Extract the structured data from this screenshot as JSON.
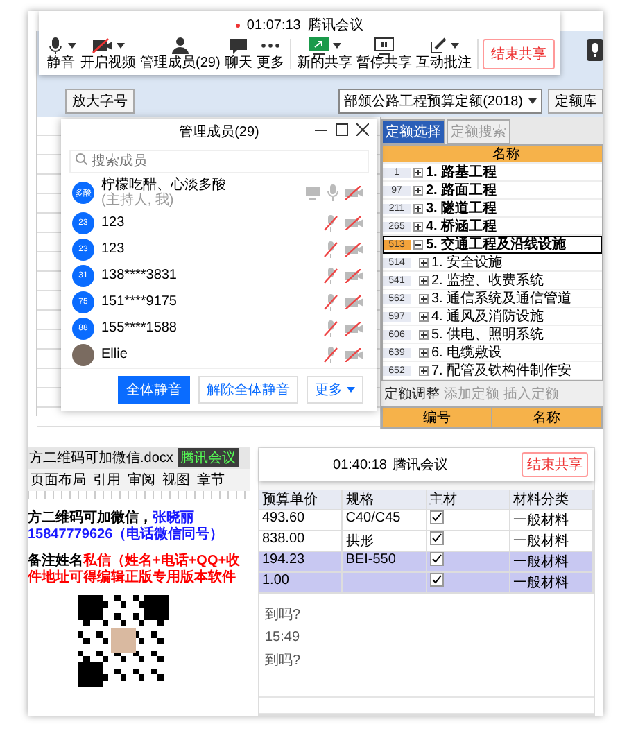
{
  "meeting_toolbar": {
    "timer": "01:07:13",
    "title": "腾讯会议",
    "buttons": [
      {
        "label": "静音",
        "caret": true
      },
      {
        "label": "开启视频",
        "caret": true
      },
      {
        "label": "管理成员(29)",
        "caret": false
      },
      {
        "label": "聊天",
        "caret": false
      },
      {
        "label": "更多",
        "caret": false
      },
      {
        "label": "新的共享",
        "caret": true
      },
      {
        "label": "暂停共享",
        "caret": false
      },
      {
        "label": "互动批注",
        "caret": true
      }
    ],
    "end_button": "结束共享"
  },
  "app": {
    "zoom_button": "放大字号",
    "quota_dropdown": "部颁公路工程预算定额(2018)",
    "library_button": "定额库",
    "adjust_button": "定额调整",
    "tabs": [
      {
        "label": "定额选择",
        "selected": true
      },
      {
        "label": "定额搜索",
        "selected": false
      }
    ],
    "tree": {
      "header": "名称",
      "items": [
        {
          "code": "1",
          "name": "1. 路基工程",
          "expanded": false,
          "selected": false
        },
        {
          "code": "97",
          "name": "2. 路面工程",
          "expanded": false,
          "selected": false
        },
        {
          "code": "211",
          "name": "3. 隧道工程",
          "expanded": false,
          "selected": false
        },
        {
          "code": "265",
          "name": "4. 桥涵工程",
          "expanded": false,
          "selected": false
        },
        {
          "code": "513",
          "name": "5. 交通工程及沿线设施",
          "expanded": true,
          "selected": true,
          "children": [
            {
              "code": "514",
              "name": "1. 安全设施"
            },
            {
              "code": "541",
              "name": "2. 监控、收费系统"
            },
            {
              "code": "562",
              "name": "3. 通信系统及通信管道"
            },
            {
              "code": "597",
              "name": "4. 通风及消防设施"
            },
            {
              "code": "606",
              "name": "5. 供电、照明系统"
            },
            {
              "code": "639",
              "name": "6. 电缆敷设"
            },
            {
              "code": "652",
              "name": "7. 配管及铁构件制作安"
            }
          ]
        }
      ]
    },
    "actions": [
      "添加定额",
      "插入定额"
    ],
    "grid_columns": [
      "编号",
      "名称"
    ]
  },
  "members_dialog": {
    "title": "管理成员(29)",
    "search": {
      "placeholder": "搜索成员"
    },
    "members": [
      {
        "kind": "number",
        "avatar": "多酸",
        "name": "柠檬吃醋、心淡多酸",
        "role": "(主持人, 我)",
        "mic_on": true
      },
      {
        "kind": "number",
        "avatar": "23",
        "name": "123",
        "mic_on": false
      },
      {
        "kind": "number",
        "avatar": "23",
        "name": "123",
        "mic_on": false
      },
      {
        "kind": "number",
        "avatar": "31",
        "name": "138****3831",
        "mic_on": false
      },
      {
        "kind": "number",
        "avatar": "75",
        "name": "151****9175",
        "mic_on": false
      },
      {
        "kind": "number",
        "avatar": "88",
        "name": "155****1588",
        "mic_on": false
      },
      {
        "kind": "photo",
        "name": "Ellie",
        "mic_on": false
      }
    ],
    "buttons": [
      {
        "label": "全体静音",
        "kind": "primary"
      },
      {
        "label": "解除全体静音",
        "kind": "plain"
      },
      {
        "label": "更多",
        "kind": "menu"
      }
    ]
  },
  "document": {
    "filename": "方二维码可加微信.docx",
    "meeting_badge": "腾讯会议",
    "menu": [
      "页面布局",
      "引用",
      "审阅",
      "视图",
      "章节"
    ],
    "lines": [
      [
        {
          "text": "方二维码可加微信，",
          "color": "#000000"
        },
        {
          "text": "张晓丽 15847779626（电话微信同号）",
          "color": "#1a1aff"
        }
      ],
      [
        {
          "text": "备注姓名",
          "color": "#000000"
        },
        {
          "text": "私信（姓名+电话+QQ+收件地址可得编辑正版专用版本软件",
          "color": "#ff0000"
        }
      ]
    ]
  },
  "second_screen": {
    "timer": "01:40:18",
    "title": "腾讯会议",
    "end_button": "结束共享",
    "columns": [
      "预算单价",
      "规格",
      "主材",
      "材料分类"
    ],
    "rows": [
      {
        "cells": [
          "493.60",
          "C40/C45"
        ],
        "main_material": true,
        "category": "一般材料",
        "selected": false
      },
      {
        "cells": [
          "838.00",
          "拱形"
        ],
        "main_material": true,
        "category": "一般材料",
        "selected": false
      },
      {
        "cells": [
          "194.23",
          "BEI-550"
        ],
        "main_material": true,
        "category": "一般材料",
        "selected": true
      },
      {
        "cells": [
          "1.00",
          ""
        ],
        "main_material": true,
        "category": "一般材料",
        "selected": true
      }
    ],
    "chat": [
      {
        "text": "到吗?"
      },
      {
        "text": "15:49"
      },
      {
        "text": "到吗?"
      }
    ]
  }
}
